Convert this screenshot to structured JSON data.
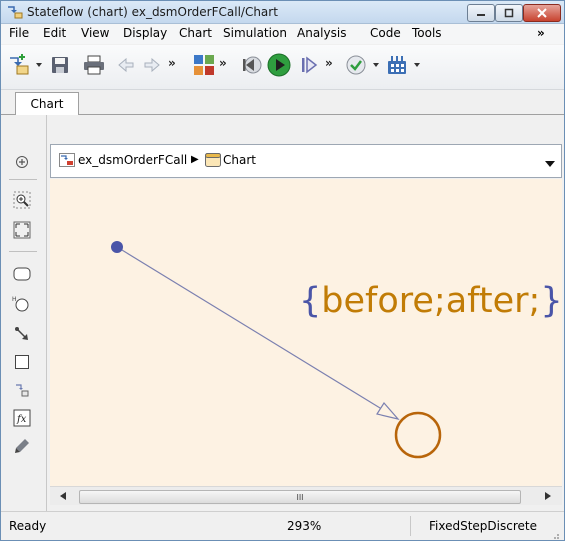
{
  "window": {
    "title": "Stateflow (chart) ex_dsmOrderFCall/Chart"
  },
  "menu": {
    "items": [
      "File",
      "Edit",
      "View",
      "Display",
      "Chart",
      "Simulation",
      "Analysis",
      "Code",
      "Tools"
    ],
    "overflow": "»"
  },
  "toolbar": {
    "more": "»",
    "icons": [
      "new-model-icon",
      "save-icon",
      "print-icon",
      "back-icon",
      "forward-icon",
      "library-icon",
      "step-back-icon",
      "run-icon",
      "step-forward-icon",
      "check-icon",
      "build-icon"
    ]
  },
  "tabs": [
    "Chart"
  ],
  "breadcrumb": {
    "model": "ex_dsmOrderFCall",
    "separator": "▶",
    "chart": "Chart"
  },
  "palette": {
    "tools": [
      "zoom-in-icon",
      "fit-view-icon",
      "state-tool-icon",
      "history-junction-icon",
      "default-transition-icon",
      "box-tool-icon",
      "simulink-function-icon",
      "matlab-function-icon",
      "annotation-icon"
    ]
  },
  "canvas": {
    "state_label": {
      "open": "{",
      "body": "before;after;",
      "close": "}"
    }
  },
  "scrollbar": {
    "thumb_grip": "III"
  },
  "status": {
    "ready": "Ready",
    "zoom": "293%",
    "solver": "FixedStepDiscrete"
  },
  "colors": {
    "canvas_bg": "#fdf2e3",
    "transition": "#7b80b0",
    "junction": "#4a55a8",
    "state_stroke": "#b8650a",
    "label_text": "#c17c06"
  }
}
